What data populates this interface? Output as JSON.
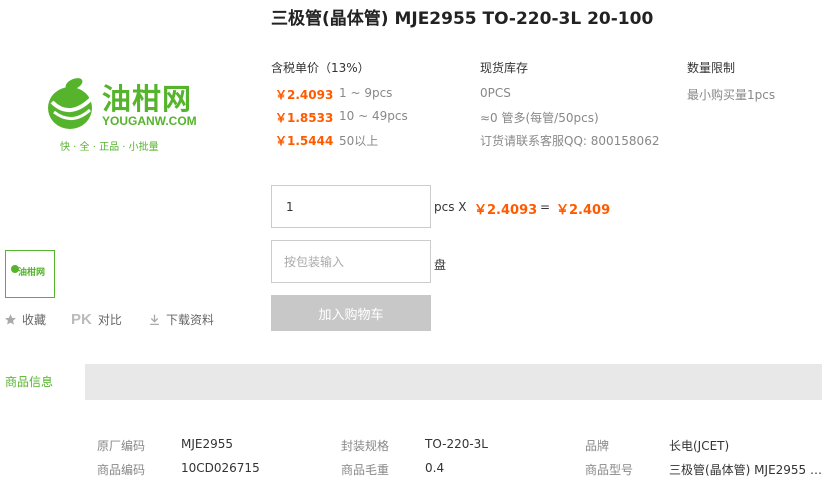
{
  "product": {
    "title": "三极管(晶体管) MJE2955 TO-220-3L 20-100"
  },
  "logo": {
    "cn": "油柑网",
    "en": "YOUGANW.COM",
    "slogan": "快 · 全 · 正品 · 小批量",
    "brand_color": "#55b42c"
  },
  "thumbnail": {
    "cn": "油柑网"
  },
  "actions": {
    "favorite": "收藏",
    "pk": "PK",
    "compare": "对比",
    "download": "下载资料"
  },
  "pricing": {
    "headers": {
      "price": "含税单价（13%）",
      "stock": "现货库存",
      "limit": "数量限制"
    },
    "tiers": [
      {
        "price": "￥2.4093",
        "range": "1 ~ 9pcs"
      },
      {
        "price": "￥1.8533",
        "range": "10 ~ 49pcs"
      },
      {
        "price": "￥1.5444",
        "range": "50以上"
      }
    ],
    "stock_lines": [
      "0PCS",
      "≈0 管多(每管/50pcs)",
      "订货请联系客服QQ: 800158062"
    ],
    "limit_text": "最小购买量1pcs",
    "accent_color": "#ff5a00"
  },
  "order": {
    "qty_value": "1",
    "qty_unit": "pcs X",
    "unit_price": "￥2.4093",
    "equals": "=",
    "total": "￥2.409",
    "pkg_placeholder": "按包装输入",
    "pkg_unit": "盘",
    "add_to_cart": "加入购物车"
  },
  "tabs": {
    "active": "商品信息"
  },
  "attributes": [
    {
      "key": "原厂编码",
      "value": "MJE2955"
    },
    {
      "key": "封装规格",
      "value": "TO-220-3L"
    },
    {
      "key": "品牌",
      "value": "长电(JCET)"
    },
    {
      "key": "商品编码",
      "value": "10CD026715"
    },
    {
      "key": "商品毛重",
      "value": "0.4"
    },
    {
      "key": "商品型号",
      "value": "三极管(晶体管) MJE2955 T..."
    }
  ]
}
